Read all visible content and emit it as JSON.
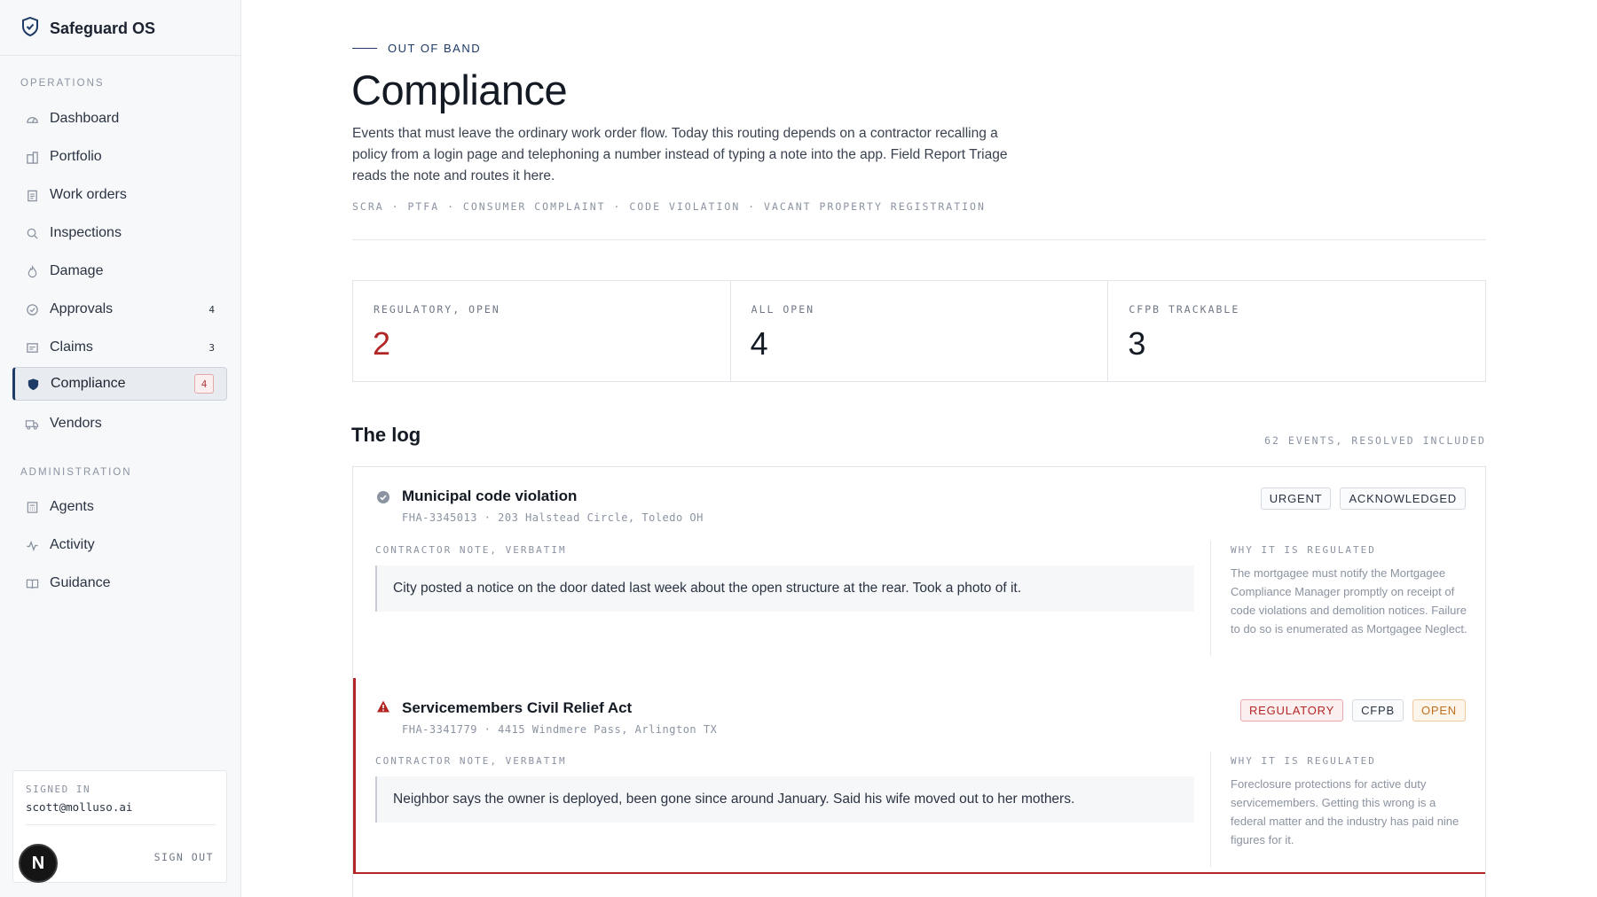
{
  "app": {
    "name": "Safeguard OS"
  },
  "sidebar": {
    "sections": [
      {
        "label": "OPERATIONS",
        "items": [
          {
            "label": "Dashboard",
            "count": ""
          },
          {
            "label": "Portfolio",
            "count": ""
          },
          {
            "label": "Work orders",
            "count": ""
          },
          {
            "label": "Inspections",
            "count": ""
          },
          {
            "label": "Damage",
            "count": ""
          },
          {
            "label": "Approvals",
            "count": "4"
          },
          {
            "label": "Claims",
            "count": "3"
          },
          {
            "label": "Compliance",
            "count": "4",
            "active": true
          },
          {
            "label": "Vendors",
            "count": ""
          }
        ]
      },
      {
        "label": "ADMINISTRATION",
        "items": [
          {
            "label": "Agents"
          },
          {
            "label": "Activity"
          },
          {
            "label": "Guidance"
          }
        ]
      }
    ],
    "signin": {
      "label": "SIGNED IN",
      "email": "scott@molluso.ai",
      "signout": "SIGN OUT"
    },
    "avatar_letter": "N"
  },
  "page": {
    "eyebrow": "OUT OF BAND",
    "title": "Compliance",
    "intro": "Events that must leave the ordinary work order flow. Today this routing depends on a contractor recalling a policy from a login page and telephoning a number instead of typing a note into the app. Field Report Triage reads the note and routes it here.",
    "tags": "SCRA · PTFA · CONSUMER COMPLAINT · CODE VIOLATION · VACANT PROPERTY REGISTRATION"
  },
  "stats": [
    {
      "label": "REGULATORY, OPEN",
      "value": "2"
    },
    {
      "label": "ALL OPEN",
      "value": "4"
    },
    {
      "label": "CFPB TRACKABLE",
      "value": "3"
    }
  ],
  "log": {
    "title": "The log",
    "meta": "62 EVENTS, RESOLVED INCLUDED",
    "entries": [
      {
        "title": "Municipal code violation",
        "ref": "FHA-3345013 · 203 Halstead Circle, Toledo OH",
        "badges": [
          "URGENT",
          "ACKNOWLEDGED"
        ],
        "note_label": "CONTRACTOR NOTE, VERBATIM",
        "note": "City posted a notice on the door dated last week about the open structure at the rear. Took a photo of it.",
        "why_label": "WHY IT IS REGULATED",
        "why": "The mortgagee must notify the Mortgagee Compliance Manager promptly on receipt of code violations and demolition notices. Failure to do so is enumerated as Mortgagee Neglect."
      },
      {
        "title": "Servicemembers Civil Relief Act",
        "ref": "FHA-3341779 · 4415 Windmere Pass, Arlington TX",
        "badges": [
          "REGULATORY",
          "CFPB",
          "OPEN"
        ],
        "note_label": "CONTRACTOR NOTE, VERBATIM",
        "note": "Neighbor says the owner is deployed, been gone since around January. Said his wife moved out to her mothers.",
        "why_label": "WHY IT IS REGULATED",
        "why": "Foreclosure protections for active duty servicemembers. Getting this wrong is a federal matter and the industry has paid nine figures for it."
      }
    ]
  },
  "colors": {
    "accent": "#1e3a66",
    "alert": "#b32626",
    "open": "#c07020"
  }
}
